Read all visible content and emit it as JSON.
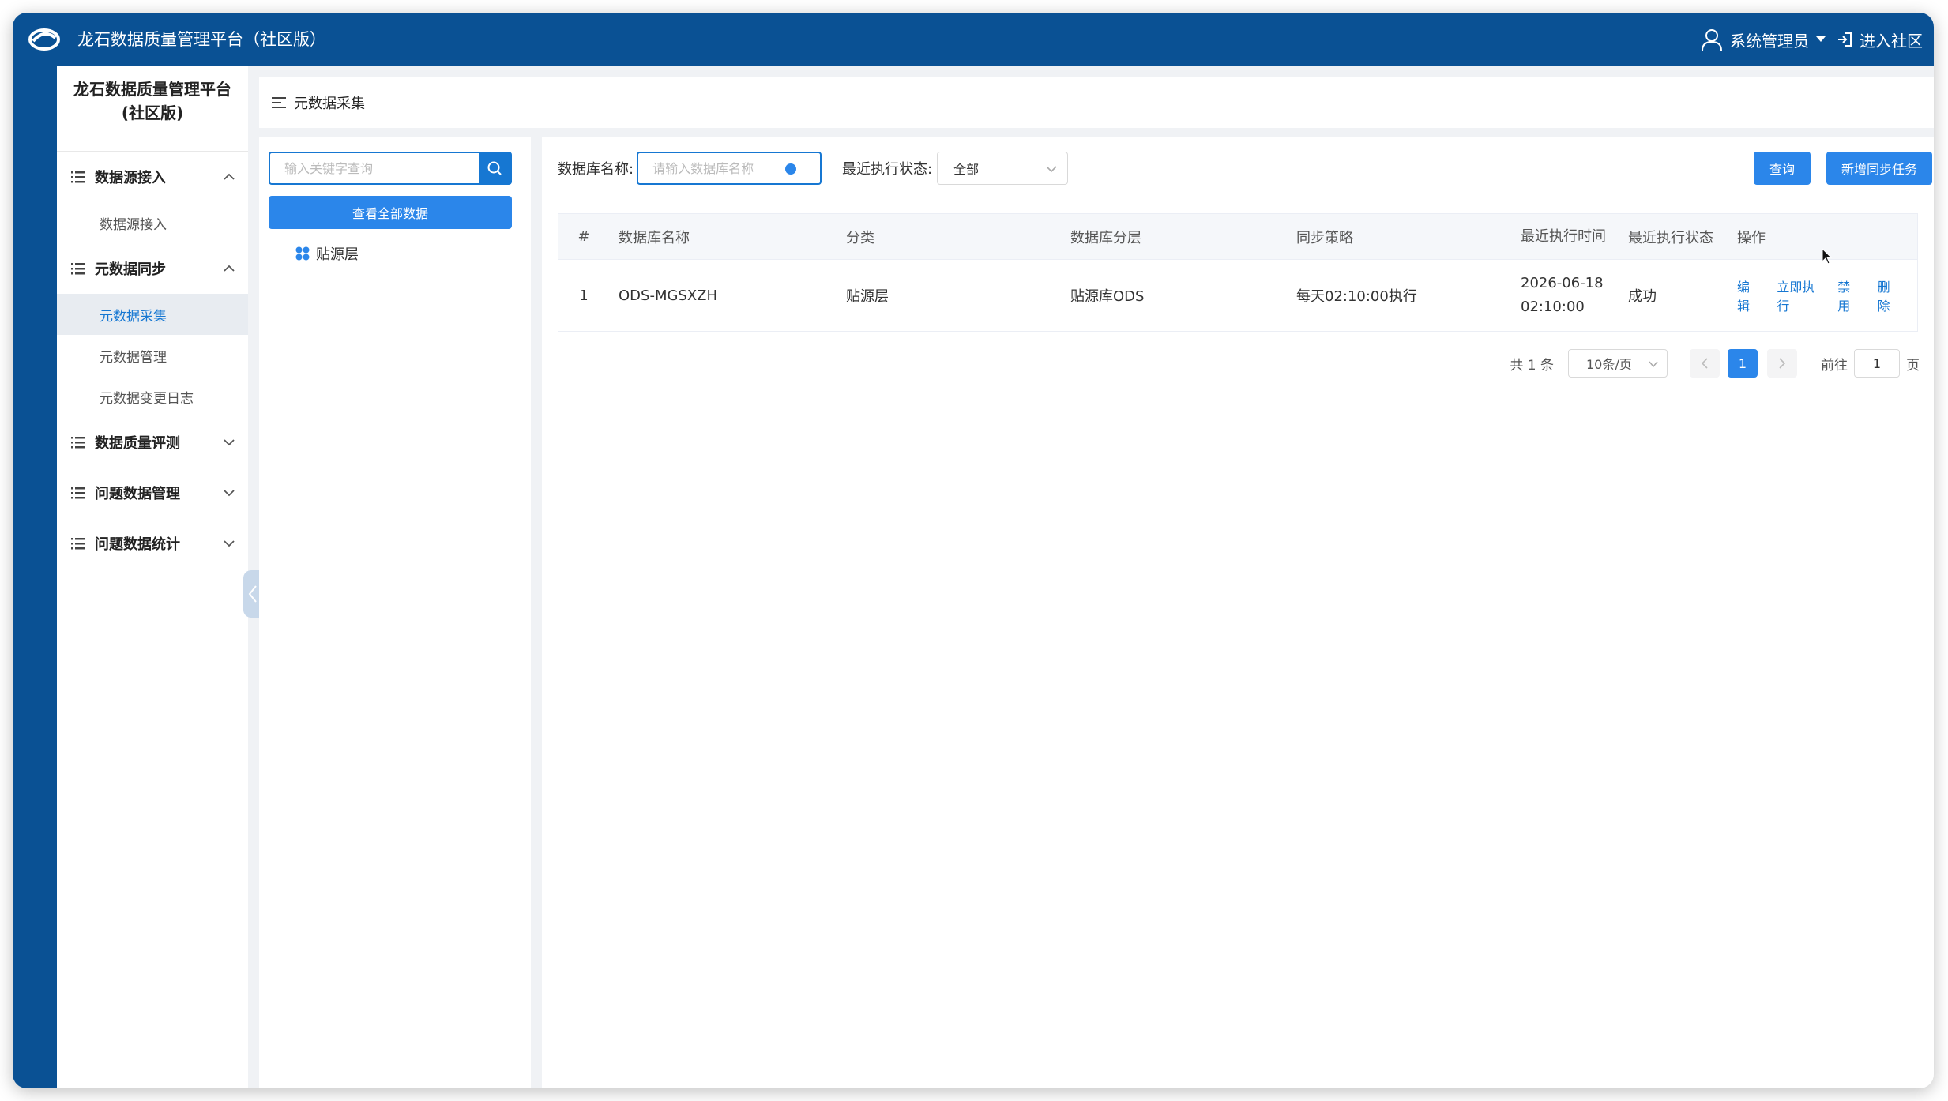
{
  "app": {
    "title": "龙石数据质量管理平台（社区版）",
    "user": "系统管理员",
    "enter_community": "进入社区"
  },
  "sidebar": {
    "title_line1": "龙石数据质量管理平台",
    "title_line2": "(社区版)",
    "groups": [
      {
        "label": "数据源接入",
        "expanded": true,
        "items": [
          "数据源接入"
        ]
      },
      {
        "label": "元数据同步",
        "expanded": true,
        "items": [
          "元数据采集",
          "元数据管理",
          "元数据变更日志"
        ],
        "active_item": "元数据采集"
      },
      {
        "label": "数据质量评测",
        "expanded": false,
        "items": []
      },
      {
        "label": "问题数据管理",
        "expanded": false,
        "items": []
      },
      {
        "label": "问题数据统计",
        "expanded": false,
        "items": []
      }
    ]
  },
  "breadcrumb": {
    "current": "元数据采集"
  },
  "tree": {
    "search_placeholder": "输入关键字查询",
    "view_all_label": "查看全部数据",
    "nodes": [
      {
        "label": "贴源层"
      }
    ]
  },
  "filters": {
    "db_name_label": "数据库名称:",
    "db_name_placeholder": "请输入数据库名称",
    "db_name_value": "",
    "status_label": "最近执行状态:",
    "status_value": "全部",
    "query_button": "查询",
    "add_button": "新增同步任务"
  },
  "table": {
    "headers": [
      "#",
      "数据库名称",
      "分类",
      "数据库分层",
      "同步策略",
      "最近执行时间",
      "最近执行状态",
      "操作"
    ],
    "rows": [
      {
        "index": "1",
        "db_name": "ODS-MGSXZH",
        "category": "贴源层",
        "layer": "贴源库ODS",
        "strategy": "每天02:10:00执行",
        "last_time_date": "2026-06-18",
        "last_time_clock": "02:10:00",
        "status": "成功",
        "ops": [
          "编辑",
          "立即执行",
          "禁用",
          "删除"
        ]
      }
    ]
  },
  "pagination": {
    "total_text": "共 1 条",
    "page_size": "10条/页",
    "current_page": "1",
    "goto_prefix": "前往",
    "goto_value": "1",
    "goto_suffix": "页"
  },
  "colors": {
    "brand": "#0a5194",
    "accent": "#2b86ea",
    "link": "#1677d2"
  }
}
